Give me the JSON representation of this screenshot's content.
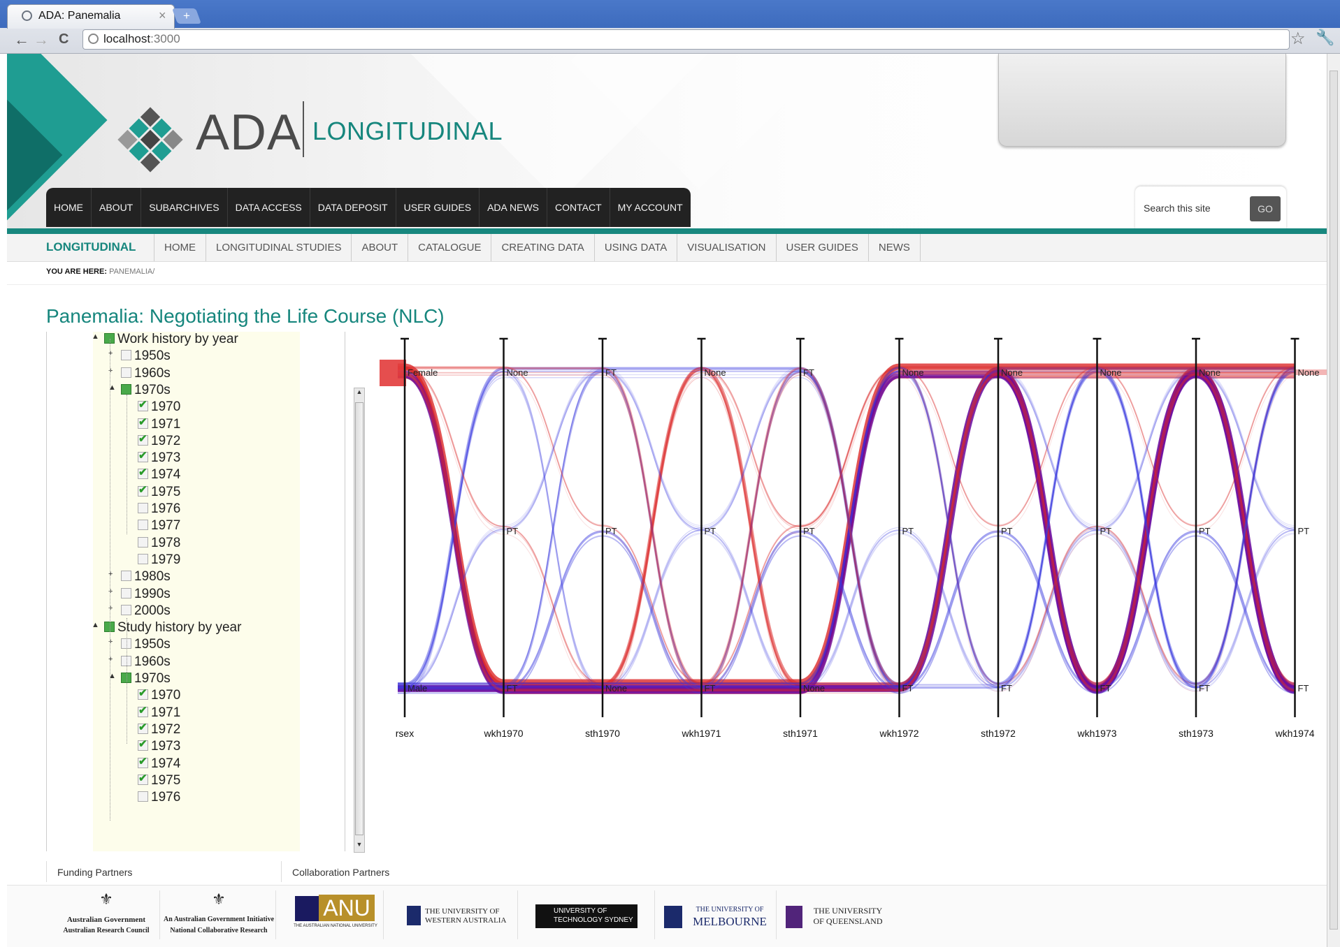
{
  "browser": {
    "tab_title": "ADA: Panemalia",
    "tab_close": "×",
    "newtab": "+",
    "url_host": "localhost",
    "url_port": ":3000",
    "back": "←",
    "forward": "→",
    "reload": "C",
    "star": "☆",
    "wrench": "🔧"
  },
  "header": {
    "logo_ada": "ADA",
    "logo_longitudinal": "LONGITUDINAL",
    "main_nav": [
      "HOME",
      "ABOUT",
      "SUBARCHIVES",
      "DATA ACCESS",
      "DATA DEPOSIT",
      "USER GUIDES",
      "ADA NEWS",
      "CONTACT",
      "MY ACCOUNT"
    ],
    "search_placeholder": "Search this site",
    "search_button": "GO"
  },
  "subnav": {
    "brand": "LONGITUDINAL",
    "items": [
      "HOME",
      "LONGITUDINAL STUDIES",
      "ABOUT",
      "CATALOGUE",
      "CREATING DATA",
      "USING DATA",
      "VISUALISATION",
      "USER GUIDES",
      "NEWS"
    ]
  },
  "breadcrumb": {
    "label": "YOU ARE HERE:",
    "value": "PANEMALIA/"
  },
  "page_title": "Panemalia: Negotiating the Life Course (NLC)",
  "tree": [
    {
      "label": "Work history by year",
      "level": 0,
      "state": "partial",
      "expander": "▲"
    },
    {
      "label": "1950s",
      "level": 1,
      "state": "off",
      "expander": "+"
    },
    {
      "label": "1960s",
      "level": 1,
      "state": "off",
      "expander": "+"
    },
    {
      "label": "1970s",
      "level": 1,
      "state": "partial",
      "expander": "▲"
    },
    {
      "label": "1970",
      "level": 2,
      "state": "checked"
    },
    {
      "label": "1971",
      "level": 2,
      "state": "checked"
    },
    {
      "label": "1972",
      "level": 2,
      "state": "checked"
    },
    {
      "label": "1973",
      "level": 2,
      "state": "checked"
    },
    {
      "label": "1974",
      "level": 2,
      "state": "checked"
    },
    {
      "label": "1975",
      "level": 2,
      "state": "checked"
    },
    {
      "label": "1976",
      "level": 2,
      "state": "off"
    },
    {
      "label": "1977",
      "level": 2,
      "state": "off"
    },
    {
      "label": "1978",
      "level": 2,
      "state": "off"
    },
    {
      "label": "1979",
      "level": 2,
      "state": "off"
    },
    {
      "label": "1980s",
      "level": 1,
      "state": "off",
      "expander": "+"
    },
    {
      "label": "1990s",
      "level": 1,
      "state": "off",
      "expander": "+"
    },
    {
      "label": "2000s",
      "level": 1,
      "state": "off",
      "expander": "+"
    },
    {
      "label": "Study history by year",
      "level": 0,
      "state": "partial",
      "expander": "▲"
    },
    {
      "label": "1950s",
      "level": 1,
      "state": "off",
      "expander": "+"
    },
    {
      "label": "1960s",
      "level": 1,
      "state": "off",
      "expander": "+"
    },
    {
      "label": "1970s",
      "level": 1,
      "state": "partial",
      "expander": "▲"
    },
    {
      "label": "1970",
      "level": 2,
      "state": "checked"
    },
    {
      "label": "1971",
      "level": 2,
      "state": "checked"
    },
    {
      "label": "1972",
      "level": 2,
      "state": "checked"
    },
    {
      "label": "1973",
      "level": 2,
      "state": "checked"
    },
    {
      "label": "1974",
      "level": 2,
      "state": "checked"
    },
    {
      "label": "1975",
      "level": 2,
      "state": "checked"
    },
    {
      "label": "1976",
      "level": 2,
      "state": "off"
    }
  ],
  "chart_data": {
    "type": "parallel-sets",
    "axes": [
      {
        "name": "rsex",
        "categories": [
          "Female",
          "Male"
        ]
      },
      {
        "name": "wkh1970",
        "categories": [
          "None",
          "PT",
          "FT"
        ]
      },
      {
        "name": "sth1970",
        "categories": [
          "FT",
          "PT",
          "None"
        ]
      },
      {
        "name": "wkh1971",
        "categories": [
          "None",
          "PT",
          "FT"
        ]
      },
      {
        "name": "sth1971",
        "categories": [
          "FT",
          "PT",
          "None"
        ]
      },
      {
        "name": "wkh1972",
        "categories": [
          "None",
          "PT",
          "FT"
        ]
      },
      {
        "name": "sth1972",
        "categories": [
          "None",
          "PT",
          "FT"
        ]
      },
      {
        "name": "wkh1973",
        "categories": [
          "None",
          "PT",
          "FT"
        ]
      },
      {
        "name": "sth1973",
        "categories": [
          "None",
          "PT",
          "FT"
        ]
      },
      {
        "name": "wkh1974",
        "categories": [
          "None",
          "PT",
          "FT"
        ]
      }
    ],
    "colors": {
      "female": "#dc2a2a",
      "male": "#3a3adf",
      "mixed": "#6a0aa0"
    }
  },
  "footer": {
    "funding_label": "Funding Partners",
    "collab_label": "Collaboration Partners",
    "logos": [
      {
        "line1": "Australian Government",
        "line2": "Australian Research Council"
      },
      {
        "line1": "An Australian Government Initiative",
        "line2": "National Collaborative Research"
      },
      {
        "line1": "ANU",
        "line2": "THE AUSTRALIAN NATIONAL UNIVERSITY"
      },
      {
        "line1": "THE UNIVERSITY OF",
        "line2": "WESTERN AUSTRALIA"
      },
      {
        "line1": "UNIVERSITY OF",
        "line2": "TECHNOLOGY SYDNEY"
      },
      {
        "line1": "THE UNIVERSITY OF",
        "line2": "MELBOURNE"
      },
      {
        "line1": "THE UNIVERSITY",
        "line2": "OF QUEENSLAND"
      }
    ]
  }
}
